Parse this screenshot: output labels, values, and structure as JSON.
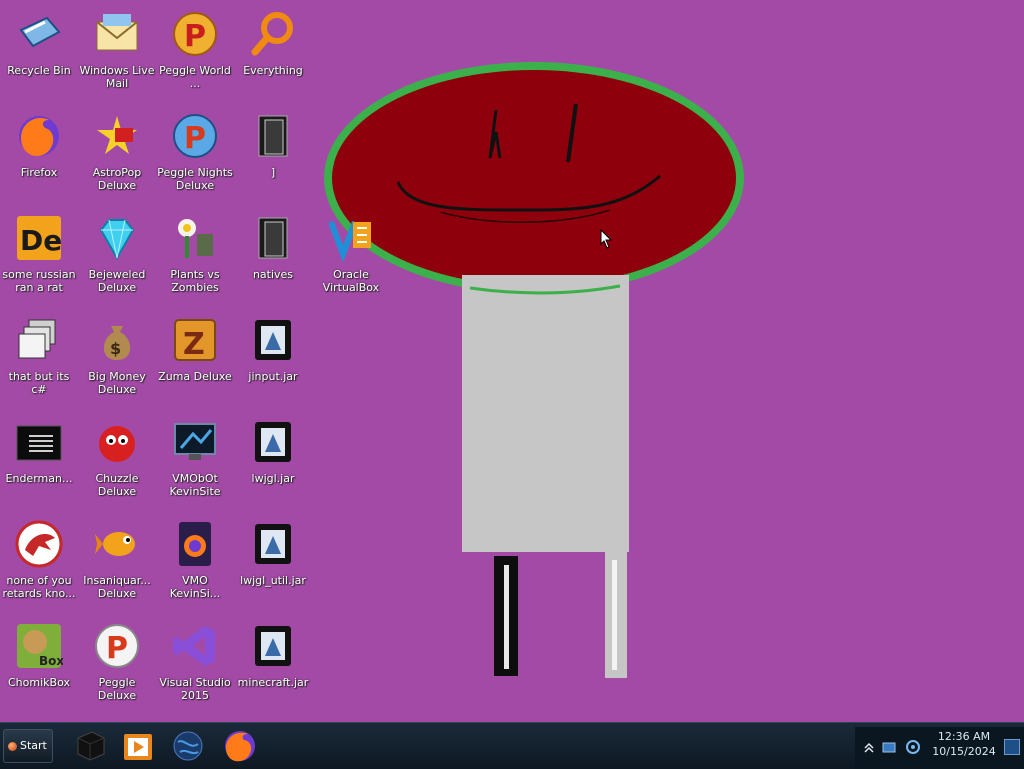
{
  "desktop": {
    "background_color": "#a34aa6",
    "icons": [
      {
        "label": "Recycle Bin",
        "icon": "recycle-bin-icon"
      },
      {
        "label": "Windows Live Mail",
        "icon": "mail-icon"
      },
      {
        "label": "Peggle World ...",
        "icon": "peggle-icon"
      },
      {
        "label": "Everything",
        "icon": "magnifier-icon"
      },
      {
        "label": "Firefox",
        "icon": "firefox-icon"
      },
      {
        "label": "AstroPop Deluxe",
        "icon": "astropop-icon"
      },
      {
        "label": "Peggle Nights Deluxe",
        "icon": "peggle-nights-icon"
      },
      {
        "label": "]",
        "icon": "folder-icon"
      },
      {
        "label": "some russian ran a rat",
        "icon": "de-icon"
      },
      {
        "label": "Bejeweled Deluxe",
        "icon": "gem-icon"
      },
      {
        "label": "Plants vs Zombies",
        "icon": "plants-icon"
      },
      {
        "label": "natives",
        "icon": "folder-icon"
      },
      {
        "label": "Oracle VirtualBox",
        "icon": "virtualbox-icon"
      },
      {
        "label": "that but its c#",
        "icon": "windows-stack-icon"
      },
      {
        "label": "Big Money Deluxe",
        "icon": "money-bag-icon"
      },
      {
        "label": "Zuma Deluxe",
        "icon": "zuma-icon"
      },
      {
        "label": "jinput.jar",
        "icon": "jar-icon"
      },
      {
        "label": "Enderman...",
        "icon": "terminal-icon"
      },
      {
        "label": "Chuzzle Deluxe",
        "icon": "chuzzle-icon"
      },
      {
        "label": "VMObOt KevinSite",
        "icon": "monitor-icon"
      },
      {
        "label": "lwjgl.jar",
        "icon": "jar-icon"
      },
      {
        "label": "none of you retards kno...",
        "icon": "dragon-icon"
      },
      {
        "label": "Insaniquar... Deluxe",
        "icon": "fish-icon"
      },
      {
        "label": "VMO KevinSi...",
        "icon": "firefox-file-icon"
      },
      {
        "label": "lwjgl_util.jar",
        "icon": "jar-icon"
      },
      {
        "label": "ChomikBox",
        "icon": "chomikbox-icon"
      },
      {
        "label": "Peggle Deluxe",
        "icon": "peggle-icon"
      },
      {
        "label": "Visual Studio 2015",
        "icon": "visual-studio-icon"
      },
      {
        "label": "minecraft.jar",
        "icon": "jar-icon"
      }
    ]
  },
  "taskbar": {
    "start_label": "Start",
    "pinned": [
      {
        "name": "black-cube-app",
        "icon": "cube-icon"
      },
      {
        "name": "media-player-app",
        "icon": "media-player-icon"
      },
      {
        "name": "globe-app",
        "icon": "globe-icon"
      },
      {
        "name": "firefox-app",
        "icon": "firefox-icon"
      }
    ],
    "tray": {
      "icons": [
        "chevron-up-icon",
        "network-icon",
        "update-icon"
      ],
      "time": "12:36 AM",
      "date": "10/15/2024"
    }
  }
}
